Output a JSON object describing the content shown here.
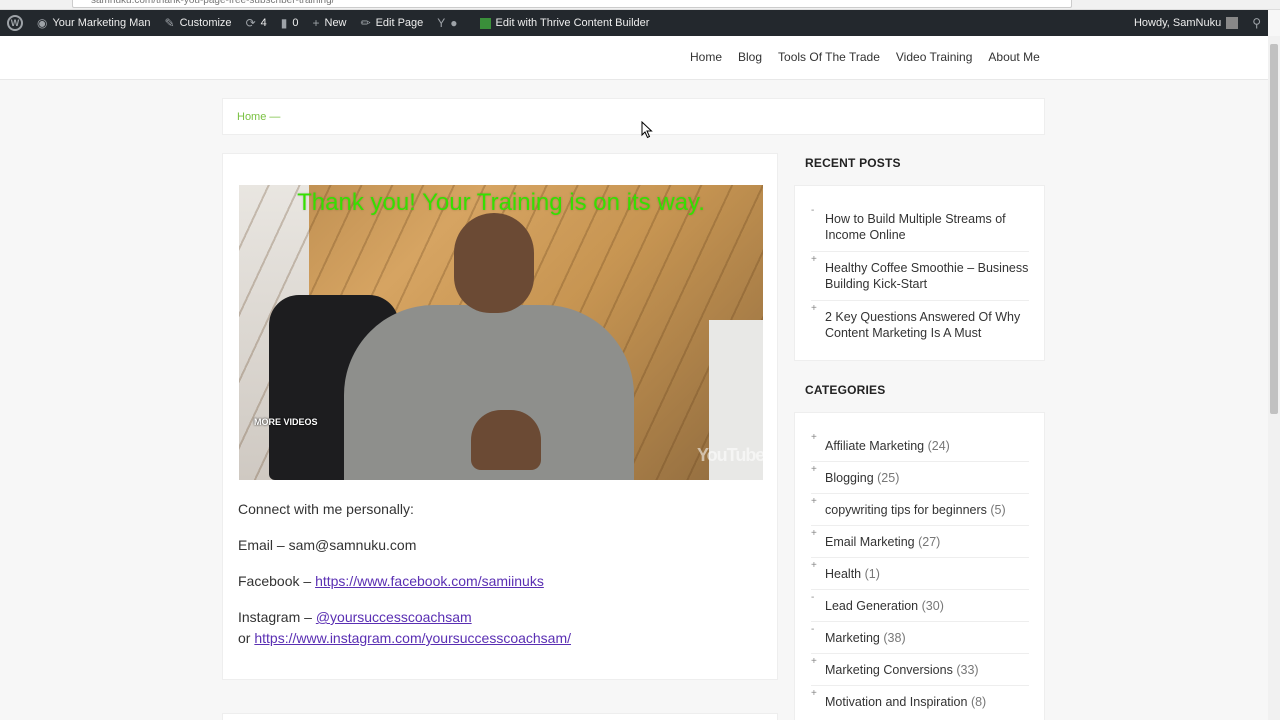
{
  "browser": {
    "url": "samnuku.com/thank-you-page-free-subscriber-training/"
  },
  "adminbar": {
    "site_name": "Your Marketing Man",
    "customize": "Customize",
    "updates_count": "4",
    "comments_count": "0",
    "new": "New",
    "edit_page": "Edit Page",
    "thrive": "Edit with Thrive Content Builder",
    "howdy": "Howdy, SamNuku"
  },
  "nav": {
    "items": [
      {
        "label": "Home"
      },
      {
        "label": "Blog"
      },
      {
        "label": "Tools Of The Trade"
      },
      {
        "label": "Video Training"
      },
      {
        "label": "About Me"
      }
    ]
  },
  "breadcrumb": {
    "home": "Home",
    "sep": "—"
  },
  "video": {
    "headline": "Thank you! Your Training is on its way.",
    "more_videos": "MORE VIDEOS",
    "youtube": "YouTube"
  },
  "content": {
    "connect": "Connect with me personally:",
    "email_prefix": "Email – sam@samnuku.com",
    "facebook_prefix": "Facebook – ",
    "facebook_link": "https://www.facebook.com/samiinuks",
    "instagram_prefix": "Instagram – ",
    "instagram_handle": "@yoursuccesscoachsam",
    "or": "or ",
    "instagram_link": "https://www.instagram.com/yoursuccesscoachsam/"
  },
  "sidebar": {
    "recent_title": "RECENT POSTS",
    "recent": [
      {
        "title": "How to Build Multiple Streams of Income Online"
      },
      {
        "title": "Healthy Coffee Smoothie – Business Building Kick-Start"
      },
      {
        "title": "2 Key Questions Answered Of Why Content Marketing Is A Must"
      }
    ],
    "categories_title": "CATEGORIES",
    "categories": [
      {
        "name": "Affiliate Marketing",
        "count": "(24)"
      },
      {
        "name": "Blogging",
        "count": "(25)"
      },
      {
        "name": "copywriting tips for beginners",
        "count": "(5)"
      },
      {
        "name": "Email Marketing",
        "count": "(27)"
      },
      {
        "name": "Health",
        "count": "(1)"
      },
      {
        "name": "Lead Generation",
        "count": "(30)"
      },
      {
        "name": "Marketing",
        "count": "(38)"
      },
      {
        "name": "Marketing Conversions",
        "count": "(33)"
      },
      {
        "name": "Motivation and Inspiration",
        "count": "(8)"
      }
    ]
  },
  "colors": {
    "accent_green": "#7ac142",
    "link_purple": "#5a2fb3",
    "headline_green": "#35e000",
    "adminbar_bg": "#23282d"
  },
  "icons": [
    "wordpress-icon",
    "dashboard-icon",
    "brush-icon",
    "updates-icon",
    "comment-icon",
    "plus-icon",
    "pencil-icon",
    "yoast-icon",
    "status-dot-icon",
    "thrive-icon",
    "avatar",
    "search-icon",
    "cursor-icon"
  ]
}
